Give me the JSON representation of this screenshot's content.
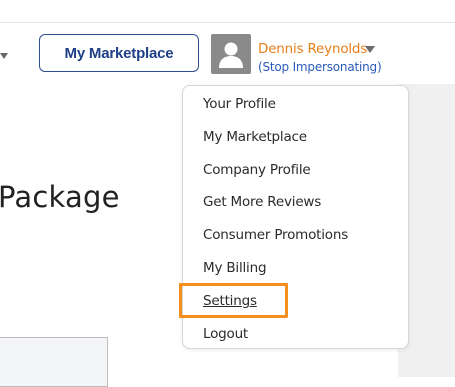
{
  "header": {
    "marketplace_button": "My Marketplace",
    "user_name": "Dennis Reynolds",
    "stop_impersonating": "(Stop Impersonating)"
  },
  "page": {
    "heading": "Package"
  },
  "user_menu": {
    "items": [
      {
        "label": "Your Profile"
      },
      {
        "label": "My Marketplace"
      },
      {
        "label": "Company Profile"
      },
      {
        "label": "Get More Reviews"
      },
      {
        "label": "Consumer Promotions"
      },
      {
        "label": "My Billing"
      },
      {
        "label": "Settings",
        "highlighted": true
      },
      {
        "label": "Logout"
      }
    ]
  },
  "colors": {
    "brand_blue": "#1f3f86",
    "accent_orange": "#e87f1b",
    "highlight_orange": "#f5901e",
    "link_blue": "#2a5bb8"
  },
  "icons": {
    "avatar": "user-avatar-icon",
    "caret": "chevron-down-icon"
  }
}
